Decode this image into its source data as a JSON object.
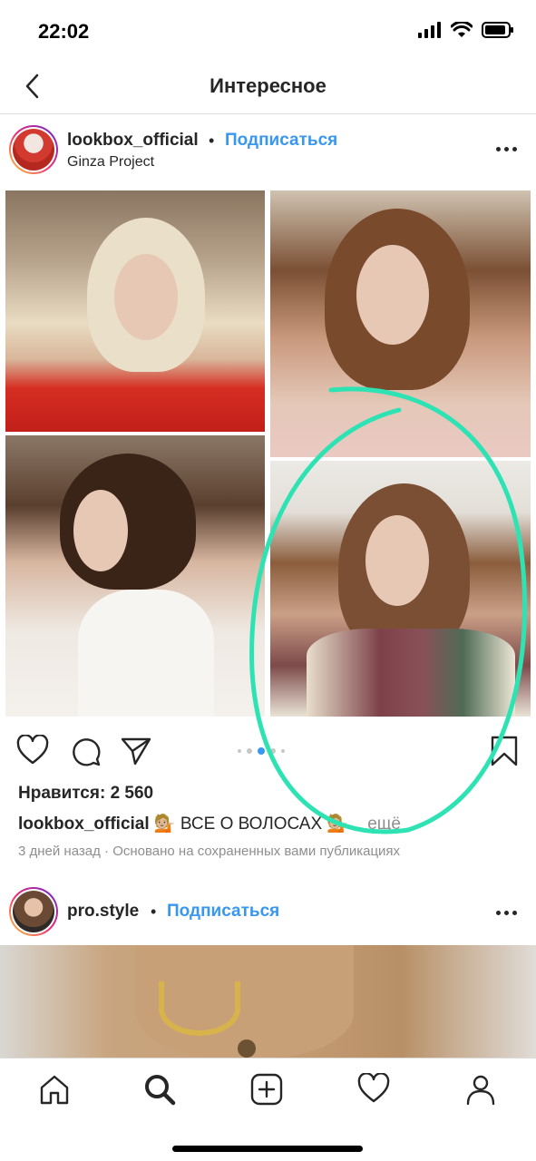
{
  "status_bar": {
    "time": "22:02",
    "icons": [
      "cellular-signal-icon",
      "wifi-icon",
      "battery-icon"
    ]
  },
  "nav": {
    "title": "Интересное",
    "back_icon": "chevron-left-icon"
  },
  "post1": {
    "username": "lookbox_official",
    "separator": "•",
    "follow_label": "Подписаться",
    "subtitle": "Ginza Project",
    "more_icon": "more-horizontal-icon",
    "carousel": {
      "count": 5,
      "active_index": 2
    },
    "actions": [
      "heart-icon",
      "comment-icon",
      "share-icon",
      "bookmark-icon"
    ],
    "likes": "Нравится: 2 560",
    "caption_user": "lookbox_official",
    "caption_text": " 💁🏼 ВСЕ О ВОЛОСАХ 💁🏼",
    "caption_more": "... ещё",
    "meta": "3 дней назад · Основано на сохраненных вами публикациях"
  },
  "post2": {
    "username": "pro.style",
    "separator": "•",
    "follow_label": "Подписаться",
    "more_icon": "more-horizontal-icon"
  },
  "highlight": {
    "color": "#2de3b4"
  },
  "tab_bar": {
    "tabs": [
      "home-icon",
      "search-icon",
      "new-post-icon",
      "activity-heart-icon",
      "profile-icon"
    ]
  },
  "colors": {
    "link": "#3897f0",
    "text": "#262626",
    "muted": "#8e8e8e"
  }
}
